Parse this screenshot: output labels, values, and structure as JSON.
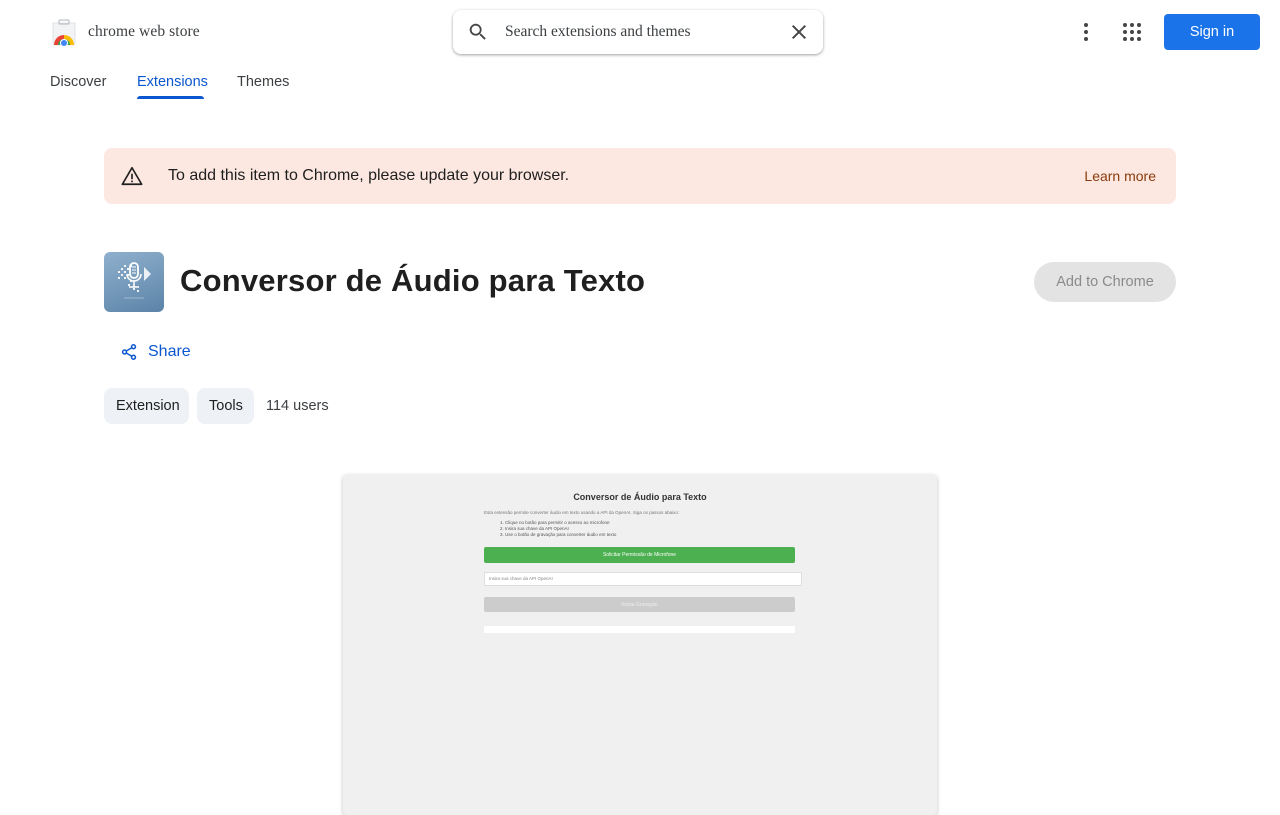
{
  "header": {
    "brand": "chrome web store",
    "search_placeholder": "Search extensions and themes",
    "sign_in": "Sign in"
  },
  "tabs": [
    {
      "label": "Discover",
      "active": false
    },
    {
      "label": "Extensions",
      "active": true
    },
    {
      "label": "Themes",
      "active": false
    }
  ],
  "banner": {
    "message": "To add this item to Chrome, please update your browser.",
    "link": "Learn more"
  },
  "item": {
    "title": "Conversor de Áudio para Texto",
    "add_button": "Add to Chrome",
    "share": "Share",
    "chips": [
      "Extension",
      "Tools"
    ],
    "users": "114 users"
  },
  "preview": {
    "title": "Conversor de Áudio para Texto",
    "description": "Esta extensão permite converter áudio em texto usando a API da OpenAI. Siga os passos abaixo:",
    "steps": [
      "1. Clique no botão para permitir o acesso ao microfone",
      "2. Insira sua chave da API OpenAI",
      "3. Use o botão de gravação para converter áudio em texto"
    ],
    "mic_button": "Solicitar Permissão de Microfone",
    "api_placeholder": "Insira sua chave da API OpenAI",
    "record_button": "Iniciar Gravação"
  },
  "colors": {
    "accent": "#1a73e8",
    "tab_active": "#0b57d0",
    "banner_bg": "#fce8e1",
    "preview_green": "#4caf50"
  }
}
